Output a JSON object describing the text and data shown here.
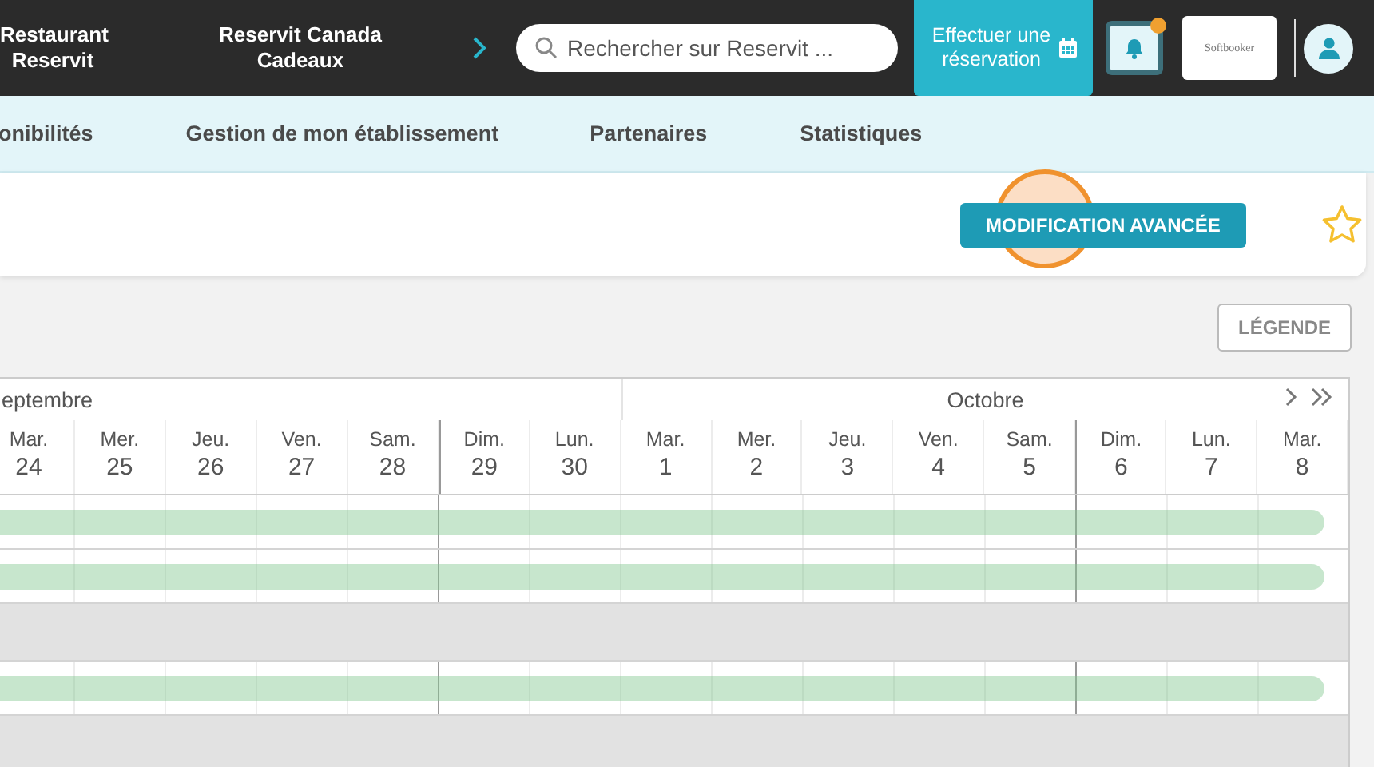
{
  "topbar": {
    "establishments": [
      "Restaurant Reservit",
      "Reservit Canada Cadeaux"
    ],
    "search": {
      "placeholder": "Rechercher sur Reservit ..."
    },
    "booking_button": "Effectuer une réservation",
    "notifications": {
      "has_new": true
    },
    "logo": "Softbooker"
  },
  "nav": {
    "items": [
      {
        "label": "onibilités"
      },
      {
        "label": "Gestion de mon établissement"
      },
      {
        "label": "Partenaires"
      },
      {
        "label": "Statistiques"
      }
    ]
  },
  "toolbar": {
    "advanced_button": "MODIFICATION AVANCÉE",
    "favorite": false
  },
  "legend_button": "LÉGENDE",
  "calendar": {
    "months": [
      {
        "label": "eptembre",
        "days": [
          {
            "weekday": "Mar.",
            "day": "24",
            "week_start": false
          },
          {
            "weekday": "Mer.",
            "day": "25",
            "week_start": false
          },
          {
            "weekday": "Jeu.",
            "day": "26",
            "week_start": false
          },
          {
            "weekday": "Ven.",
            "day": "27",
            "week_start": false
          },
          {
            "weekday": "Sam.",
            "day": "28",
            "week_start": false
          },
          {
            "weekday": "Dim.",
            "day": "29",
            "week_start": true
          },
          {
            "weekday": "Lun.",
            "day": "30",
            "week_start": false
          }
        ]
      },
      {
        "label": "Octobre",
        "days": [
          {
            "weekday": "Mar.",
            "day": "1",
            "week_start": false
          },
          {
            "weekday": "Mer.",
            "day": "2",
            "week_start": false
          },
          {
            "weekday": "Jeu.",
            "day": "3",
            "week_start": false
          },
          {
            "weekday": "Ven.",
            "day": "4",
            "week_start": false
          },
          {
            "weekday": "Sam.",
            "day": "5",
            "week_start": false
          },
          {
            "weekday": "Dim.",
            "day": "6",
            "week_start": true
          },
          {
            "weekday": "Lun.",
            "day": "7",
            "week_start": false
          },
          {
            "weekday": "Mar.",
            "day": "8",
            "week_start": false
          }
        ]
      }
    ],
    "rows": [
      {
        "kind": "open"
      },
      {
        "kind": "open"
      },
      {
        "kind": "closed"
      },
      {
        "kind": "open"
      },
      {
        "kind": "closed"
      }
    ]
  }
}
